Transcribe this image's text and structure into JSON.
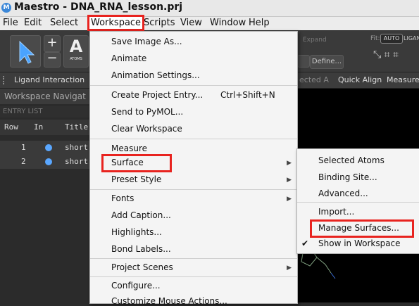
{
  "window": {
    "title": "Maestro - DNA_RNA_lesson.prj",
    "logo_letter": "M"
  },
  "menubar": [
    "File",
    "Edit",
    "Select",
    "Workspace",
    "Scripts",
    "View",
    "Window",
    "Help"
  ],
  "toolbar": {
    "atoms_label": "ATOMS",
    "atoms_letter": "A",
    "expand_label": "Expand",
    "define_label": "Define...",
    "fit_label": "Fit:",
    "auto_label": "AUTO",
    "ligand_label": "LIGAN"
  },
  "tabs": [
    "Ligand Interaction",
    "ected A",
    "Quick Align",
    "Measure"
  ],
  "workspace_nav": {
    "title": "Workspace Navigat"
  },
  "entry_list": {
    "label": "ENTRY LIST",
    "columns": [
      "Row",
      "In",
      "Title"
    ],
    "rows": [
      {
        "row": "1",
        "title": "short"
      },
      {
        "row": "2",
        "title": "short"
      }
    ]
  },
  "workspace_menu": {
    "items": [
      "Save Image As...",
      "Animate",
      "Animation Settings...",
      "Create Project Entry...",
      "Send to PyMOL...",
      "Clear Workspace",
      "Measure",
      "Surface",
      "Preset Style",
      "Fonts",
      "Add Caption...",
      "Highlights...",
      "Bond Labels...",
      "Project Scenes",
      "Configure...",
      "Customize Mouse Actions..."
    ],
    "shortcut_create": "Ctrl+Shift+N"
  },
  "surface_submenu": {
    "items": [
      "Selected Atoms",
      "Binding Site...",
      "Advanced...",
      "Import...",
      "Manage Surfaces...",
      "Show in Workspace"
    ],
    "checkmark": "✔"
  },
  "colors": {
    "highlight": "#e8231f",
    "accent": "#3b87d8"
  }
}
